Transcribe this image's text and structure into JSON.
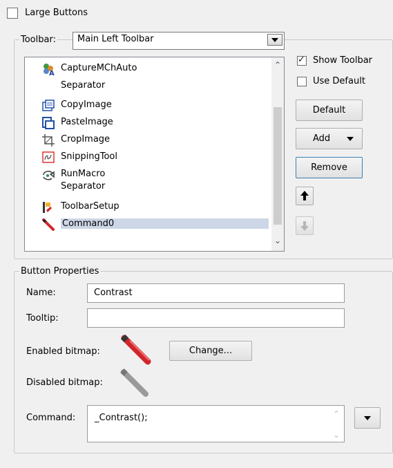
{
  "large_buttons": {
    "label": "Large Buttons",
    "checked": false
  },
  "toolbar_group": {
    "label": "Toolbar:",
    "selected": "Main Left Toolbar",
    "items": [
      {
        "label": "CaptureMChAuto",
        "icon": "capture-icon"
      },
      {
        "label": "Separator",
        "icon": ""
      },
      {
        "label": "CopyImage",
        "icon": "copy-image-icon"
      },
      {
        "label": "PasteImage",
        "icon": "paste-image-icon"
      },
      {
        "label": "CropImage",
        "icon": "crop-icon"
      },
      {
        "label": "SnippingTool",
        "icon": "snipping-icon"
      },
      {
        "label": "RunMacro",
        "icon": "run-macro-icon"
      },
      {
        "label": "Separator",
        "icon": ""
      },
      {
        "label": "ToolbarSetup",
        "icon": "toolbar-setup-icon"
      },
      {
        "label": "Command0",
        "icon": "pencil-icon",
        "selected": true
      }
    ],
    "show_toolbar": {
      "label": "Show Toolbar",
      "checked": true
    },
    "use_default": {
      "label": "Use Default",
      "checked": false
    },
    "default_label": "Default",
    "add_label": "Add",
    "remove_label": "Remove"
  },
  "button_properties": {
    "title": "Button Properties",
    "name_label": "Name:",
    "name_value": "Contrast",
    "tooltip_label": "Tooltip:",
    "tooltip_value": "",
    "enabled_label": "Enabled bitmap:",
    "change_label": "Change...",
    "disabled_label": "Disabled bitmap:",
    "command_label": "Command:",
    "command_value": "_Contrast();"
  },
  "colors": {
    "selection": "#cdd6e6",
    "pencil_red": "#d0262b",
    "pencil_gray": "#9a9a9a"
  }
}
